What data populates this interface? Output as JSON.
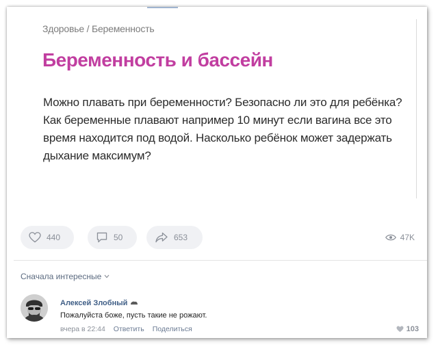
{
  "post": {
    "breadcrumb": "Здоровье / Беременность",
    "title": "Беременность и бассейн",
    "body": "Можно плавать при беременности? Безопасно ли это для ребёнка? Как беременные плавают например 10 минут если вагина все это время находится под водой. Насколько ребёнок может задержать дыхание максимум?",
    "title_color": "#c13ea0"
  },
  "actions": {
    "likes": "440",
    "comments": "50",
    "shares": "653",
    "views": "47K"
  },
  "comments_section": {
    "sort_label": "Сначала интересные",
    "comment": {
      "author": "Алексей Злобный",
      "text": "Пожалуйста боже, пусть такие не рожают.",
      "time": "вчера в 22:44",
      "reply": "Ответить",
      "share": "Поделиться",
      "likes": "103"
    }
  }
}
